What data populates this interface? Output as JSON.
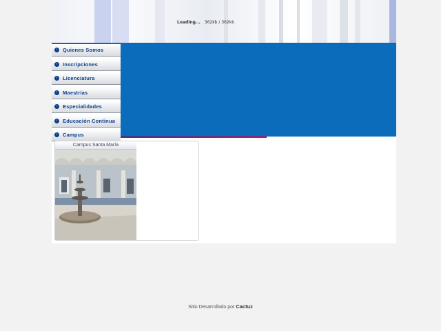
{
  "banner": {
    "loading_label": "Loading...",
    "loading_progress": "362kb / 362kb"
  },
  "menu": {
    "items": [
      {
        "label": "Quienes Somos"
      },
      {
        "label": "Inscripciones"
      },
      {
        "label": "Licenciatura"
      },
      {
        "label": "Maestrías"
      },
      {
        "label": "Especialidades"
      },
      {
        "label": "Educación Continua"
      },
      {
        "label": "Campus"
      }
    ]
  },
  "campus": {
    "title": "Campus Santa María"
  },
  "footer": {
    "prefix": "Sitio Desarrollado por",
    "brand": "Cactuz"
  },
  "colors": {
    "primary_blue": "#0a6cbb",
    "menu_text": "#0b3e8c",
    "accent_purple": "#8a2a7a"
  }
}
